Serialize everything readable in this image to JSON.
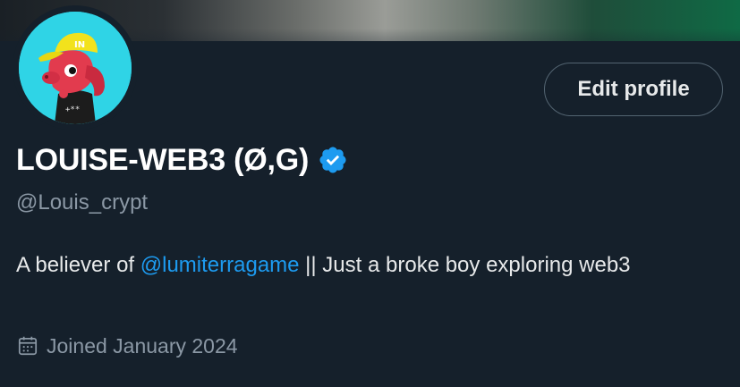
{
  "profile": {
    "display_name": "LOUISE-WEB3 (Ø,G)",
    "handle": "@Louis_crypt",
    "verified": true,
    "bio": {
      "before": "A believer of ",
      "mention": "@lumiterragame",
      "after": " || Just a broke boy exploring web3"
    },
    "joined": "Joined January 2024"
  },
  "actions": {
    "edit_profile_label": "Edit profile"
  },
  "icons": {
    "verified": "verified-badge-icon",
    "joined": "calendar-icon"
  },
  "colors": {
    "background": "#15202b",
    "accent": "#1d9bf0",
    "secondary_text": "#8b98a5",
    "avatar_background": "#2fd4e6"
  }
}
